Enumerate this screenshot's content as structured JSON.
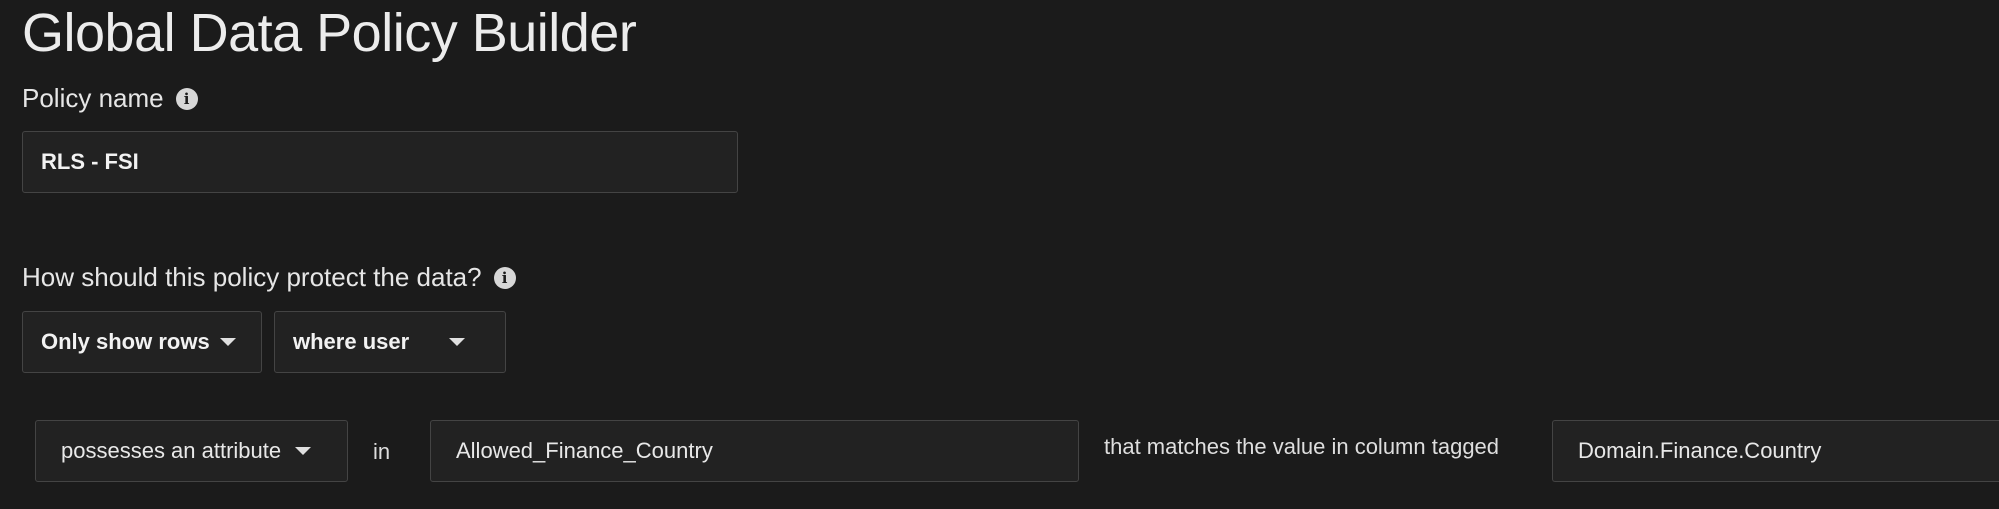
{
  "page": {
    "title": "Global Data Policy Builder"
  },
  "policy_name": {
    "label": "Policy name",
    "value": "RLS - FSI"
  },
  "protection": {
    "question": "How should this policy protect the data?",
    "action_select": "Only show rows",
    "condition_select": "where user"
  },
  "rule": {
    "attribute_select": "possesses an attribute",
    "in_text": "in",
    "attribute_value": "Allowed_Finance_Country",
    "match_text": "that matches the value in column tagged",
    "column_tag_value": "Domain.Finance.Country"
  },
  "icons": {
    "info": "info-icon",
    "dropdown": "caret-down-icon"
  }
}
